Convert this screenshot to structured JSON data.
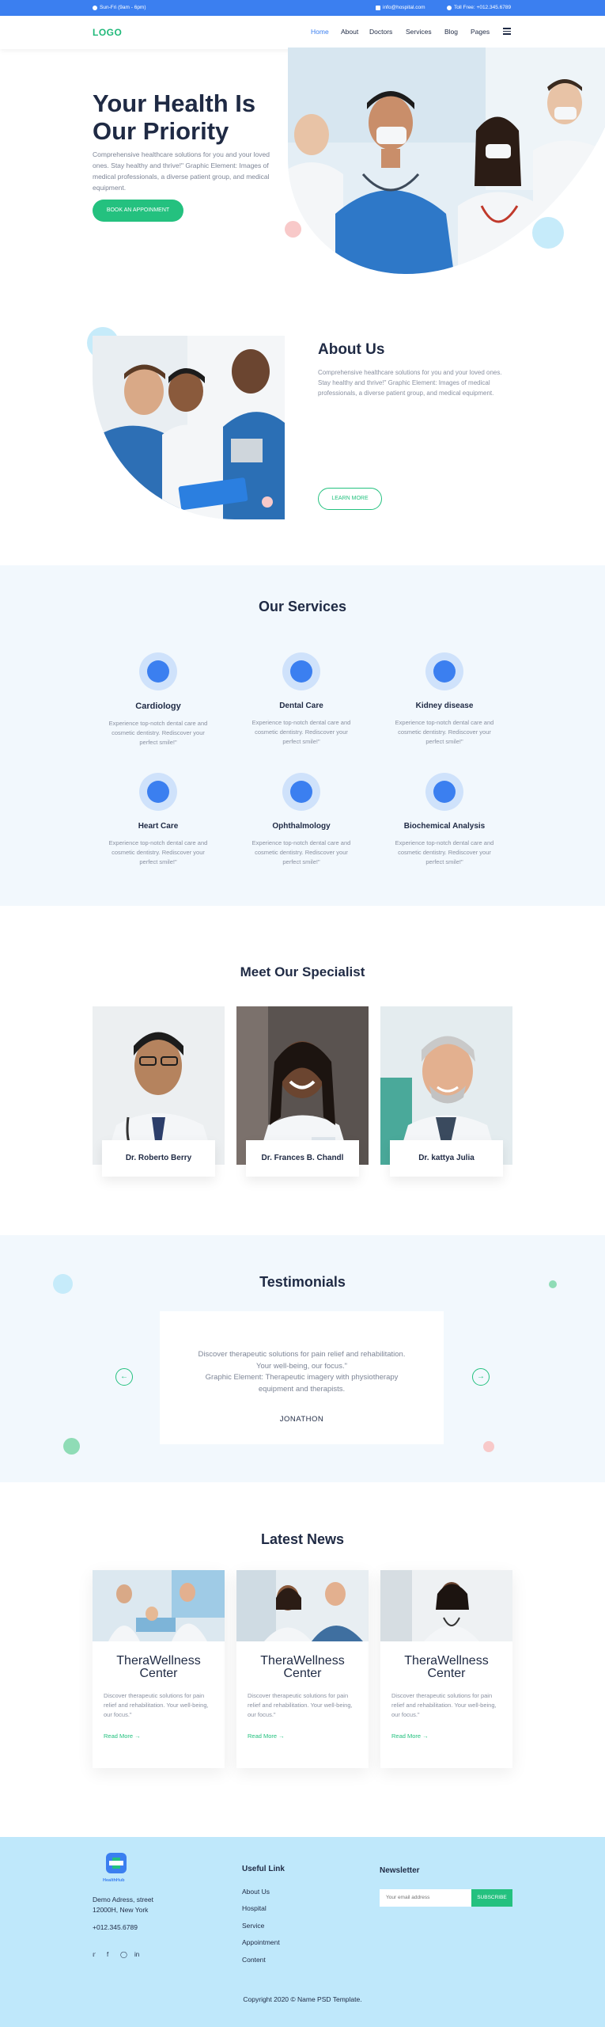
{
  "topbar": {
    "hours": "Sun-Fri (9am - 6pm)",
    "email": "info@hospital.com",
    "phone": "Toll Free: +012.345.6789"
  },
  "nav": {
    "logo": "LOGO",
    "items": [
      "Home",
      "About",
      "Doctors",
      "Services",
      "Blog",
      "Pages"
    ],
    "active": "Home"
  },
  "hero": {
    "title_line1": "Your Health Is",
    "title_line2": "Our Priority",
    "text": "Comprehensive healthcare solutions for you and your loved ones. Stay healthy and thrive!\" Graphic Element: Images of medical professionals, a diverse patient group, and medical equipment.",
    "button": "BOOK AN APPOINMENT"
  },
  "about": {
    "title": "About Us",
    "text": "Comprehensive healthcare solutions for you and your loved ones. Stay healthy and thrive!\" Graphic Element: Images of medical professionals, a diverse patient group, and medical equipment.",
    "button": "LEARN MORE"
  },
  "services": {
    "title": "Our Services",
    "items": [
      {
        "name": "Cardiology",
        "desc": "Experience top-notch dental care and cosmetic dentistry. Rediscover your perfect smile!\""
      },
      {
        "name": "Dental Care",
        "desc": "Experience top-notch dental care and cosmetic dentistry. Rediscover your perfect smile!\""
      },
      {
        "name": "Kidney disease",
        "desc": "Experience top-notch dental care and cosmetic dentistry. Rediscover your perfect smile!\""
      },
      {
        "name": "Heart Care",
        "desc": "Experience top-notch dental care and cosmetic dentistry. Rediscover your perfect smile!\""
      },
      {
        "name": "Ophthalmology",
        "desc": "Experience top-notch dental care and cosmetic dentistry. Rediscover your perfect smile!\""
      },
      {
        "name": "Biochemical Analysis",
        "desc": "Experience top-notch dental care and cosmetic dentistry. Rediscover your perfect smile!\""
      }
    ]
  },
  "specialists": {
    "title": "Meet Our Specialist",
    "items": [
      {
        "name": "Dr. Roberto Berry"
      },
      {
        "name": "Dr. Frances B. Chandl"
      },
      {
        "name": "Dr. kattya Julia"
      }
    ]
  },
  "testimonials": {
    "title": "Testimonials",
    "quote_line1": "Discover therapeutic solutions for pain relief and rehabilitation.",
    "quote_line2": "Your well-being, our focus.\"",
    "quote_line3": "Graphic Element: Therapeutic imagery with physiotherapy",
    "quote_line4": "equipment and therapists.",
    "author": "JONATHON",
    "prev_icon": "arrow-left-icon",
    "next_icon": "arrow-right-icon"
  },
  "news": {
    "title": "Latest News",
    "items": [
      {
        "title1": "TheraWellness",
        "title2": "Center",
        "text": "Discover therapeutic solutions for pain relief and rehabilitation. Your well-being, our focus.\"",
        "link": "Read More →"
      },
      {
        "title1": "TheraWellness",
        "title2": "Center",
        "text": "Discover therapeutic solutions for pain relief and rehabilitation. Your well-being, our focus.\"",
        "link": "Read More →"
      },
      {
        "title1": "TheraWellness",
        "title2": "Center",
        "text": "Discover therapeutic solutions for pain relief and rehabilitation. Your well-being, our focus.\"",
        "link": "Read More →"
      }
    ]
  },
  "footer": {
    "brand": "HealthHub",
    "address_line1": "Demo Adress, street",
    "address_line2": "12000H, New York",
    "phone": "+012.345.6789",
    "useful_title": "Useful Link",
    "links": [
      "About Us",
      "Hospital",
      "Service",
      "Appointment",
      "Content"
    ],
    "newsletter_title": "Newsletter",
    "email_placeholder": "Your email address",
    "subscribe": "SUBSCRIBE",
    "copyright": "Copyright 2020 © Name PSD Template.",
    "social": [
      "twitter-icon",
      "facebook-icon",
      "instagram-icon",
      "linkedin-icon"
    ]
  },
  "colors": {
    "primary": "#3b7ff0",
    "green": "#24c17f",
    "light_bg": "#f2f8fd",
    "footer_bg": "#bfe8fb",
    "text_dark": "#1f2a44"
  }
}
